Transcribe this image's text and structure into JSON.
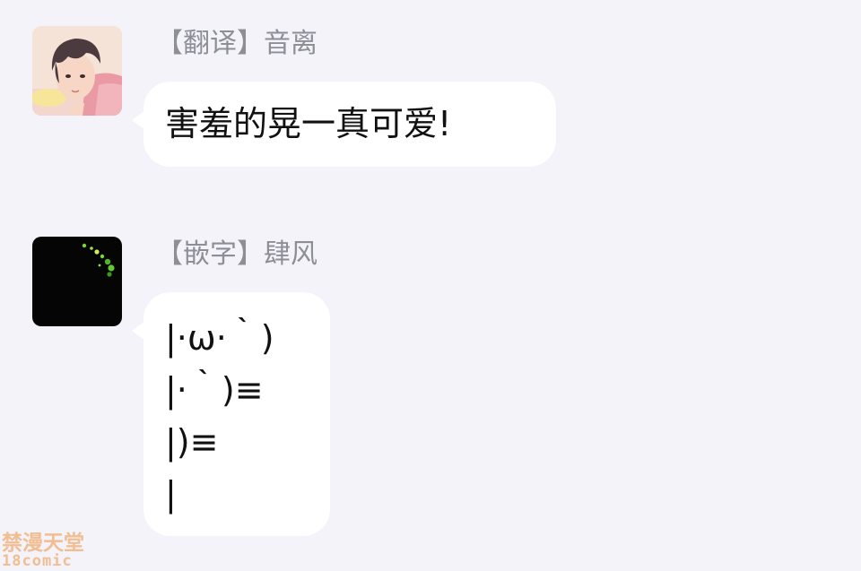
{
  "messages": [
    {
      "sender": "【翻译】音离",
      "avatar_icon": "anime-boy-avatar-icon",
      "text": "害羞的晃一真可爱!"
    },
    {
      "sender": "【嵌字】肆风",
      "avatar_icon": "dark-fireflies-avatar-icon",
      "lines": [
        "|·ω·｀)",
        "|·｀)≡",
        "|)≡",
        "|"
      ]
    }
  ],
  "watermark": {
    "line1": "禁漫天堂",
    "line2": "18comic"
  },
  "colors": {
    "background": "#f3f3f9",
    "bubble": "#ffffff",
    "sender_name": "#8e8e96",
    "message_text": "#111111",
    "watermark": "#f1b989"
  }
}
